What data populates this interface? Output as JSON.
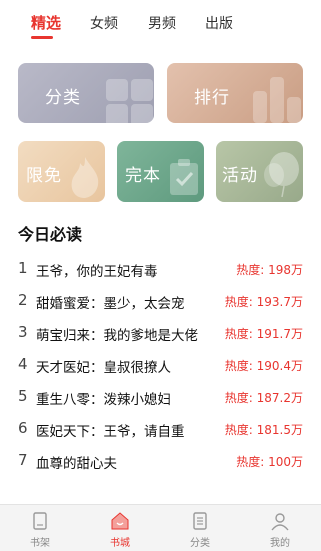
{
  "tabs": [
    {
      "label": "精选"
    },
    {
      "label": "女频"
    },
    {
      "label": "男频"
    },
    {
      "label": "出版"
    }
  ],
  "categories": {
    "fenlei": "分类",
    "paihang": "排行",
    "xianmian": "限免",
    "wanben": "完本",
    "huodong": "活动"
  },
  "section_title": "今日必读",
  "books": [
    {
      "index": "1",
      "title": "王爷，你的王妃有毒",
      "heat": "热度: 198万"
    },
    {
      "index": "2",
      "title": "甜婚蜜爱：墨少，太会宠",
      "heat": "热度: 193.7万"
    },
    {
      "index": "3",
      "title": "萌宝归来：我的爹地是大佬",
      "heat": "热度: 191.7万"
    },
    {
      "index": "4",
      "title": "天才医妃：皇叔很撩人",
      "heat": "热度: 190.4万"
    },
    {
      "index": "5",
      "title": "重生八零：泼辣小媳妇",
      "heat": "热度: 187.2万"
    },
    {
      "index": "6",
      "title": "医妃天下：王爷，请自重",
      "heat": "热度: 181.5万"
    },
    {
      "index": "7",
      "title": "血尊的甜心夫",
      "heat": "热度: 100万"
    }
  ],
  "bottom_nav": [
    {
      "label": "书架",
      "icon": "bookshelf-icon"
    },
    {
      "label": "书城",
      "icon": "bookstore-icon"
    },
    {
      "label": "分类",
      "icon": "category-icon"
    },
    {
      "label": "我的",
      "icon": "profile-icon"
    }
  ],
  "colors": {
    "accent": "#e8352f"
  }
}
